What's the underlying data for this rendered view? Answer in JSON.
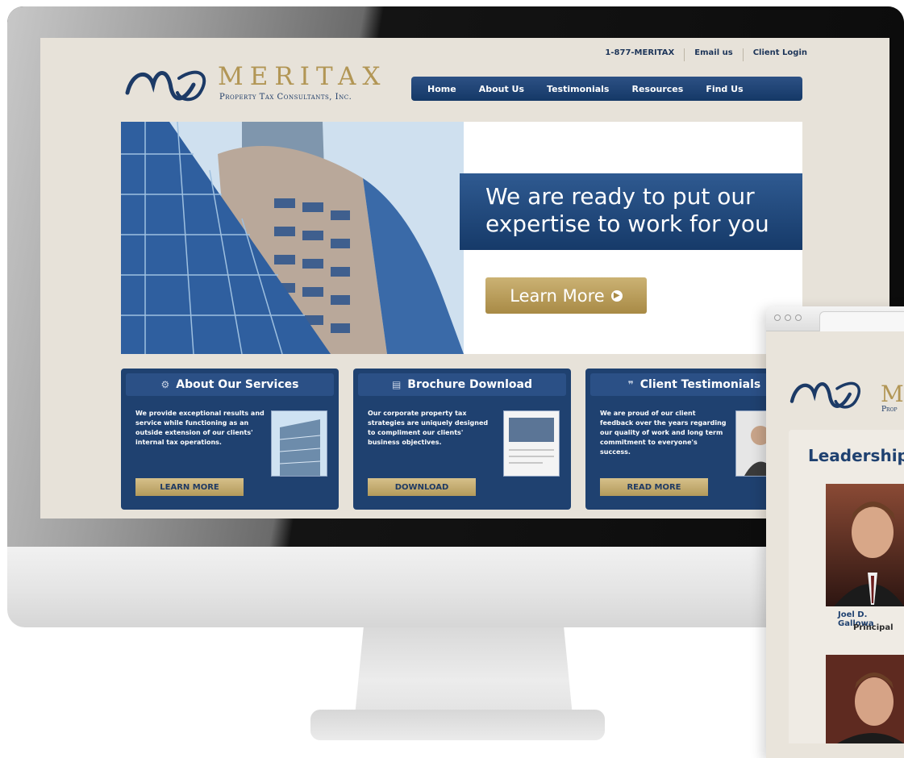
{
  "site": {
    "logo": {
      "name": "MERITAX",
      "tagline": "Property Tax Consultants, Inc."
    },
    "top_links": [
      {
        "label": "1-877-MERITAX"
      },
      {
        "label": "Email us"
      },
      {
        "label": "Client Login"
      }
    ],
    "nav": [
      {
        "label": "Home"
      },
      {
        "label": "About Us"
      },
      {
        "label": "Testimonials"
      },
      {
        "label": "Resources"
      },
      {
        "label": "Find Us"
      }
    ],
    "hero": {
      "headline_line1": "We are ready to put our",
      "headline_line2": "expertise to work for you",
      "button_label": "Learn More"
    },
    "features": [
      {
        "title": "About Our Services",
        "icon": "gears-icon",
        "text": "We provide exceptional results and service while functioning as an outside extension of our clients' internal tax operations.",
        "button": "LEARN MORE"
      },
      {
        "title": "Brochure Download",
        "icon": "document-icon",
        "text": "Our corporate property tax strategies are uniquely designed to compliment our clients' business objectives.",
        "button": "DOWNLOAD"
      },
      {
        "title": "Client Testimonials",
        "icon": "speech-bubbles-icon",
        "text": "We are proud of our client feedback over the years regarding our quality of work and long term commitment to everyone's success.",
        "button": "READ MORE"
      }
    ]
  },
  "mobile_window": {
    "logo_letter": "M",
    "logo_sub_partial": "Prop",
    "heading": "Leadership",
    "people": [
      {
        "name": "Joel D. Gallowa",
        "title": "Principal"
      }
    ]
  },
  "colors": {
    "navy": "#1f4170",
    "gold": "#b29655",
    "paper": "#e7e2d9"
  }
}
